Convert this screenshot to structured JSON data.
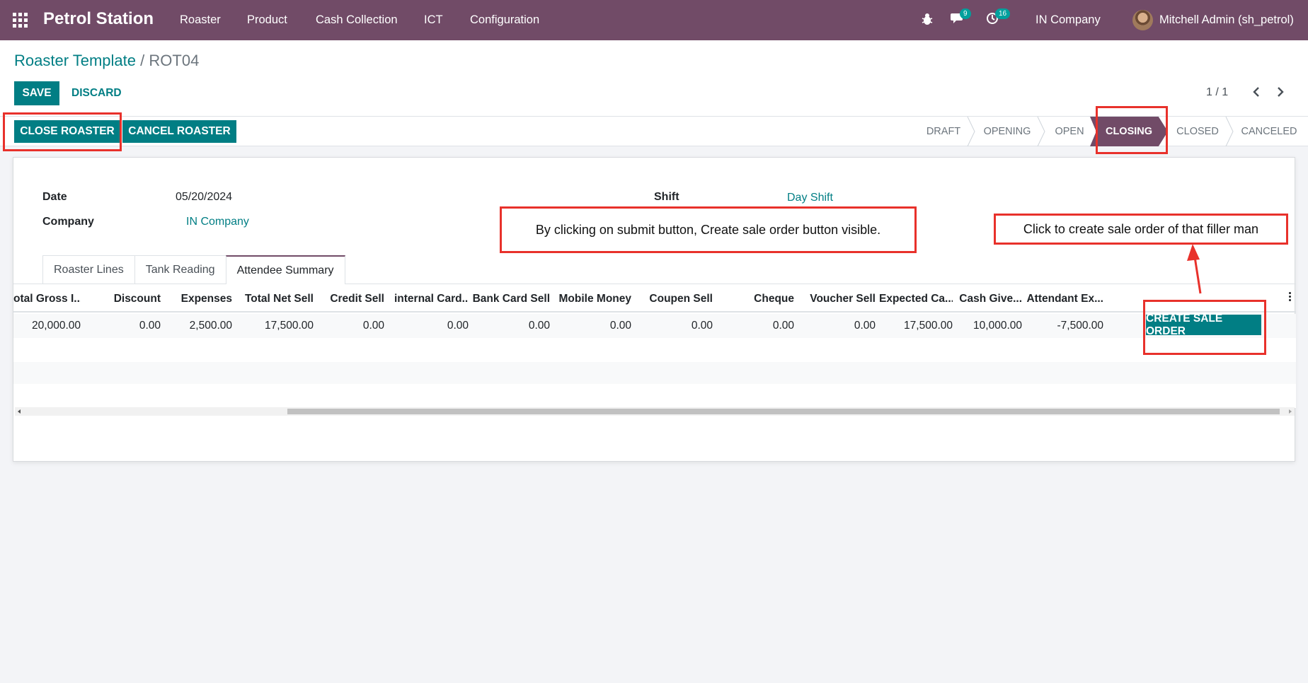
{
  "navbar": {
    "brand": "Petrol Station",
    "menu": [
      "Roaster",
      "Product",
      "Cash Collection",
      "ICT",
      "Configuration"
    ],
    "messages_count": "9",
    "activities_count": "16",
    "company": "IN Company",
    "user": "Mitchell Admin (sh_petrol)"
  },
  "breadcrumb": {
    "parent": "Roaster Template",
    "separator": "/",
    "current": "ROT04"
  },
  "toolbar": {
    "save_label": "SAVE",
    "discard_label": "DISCARD",
    "pager": "1 / 1"
  },
  "header_buttons": {
    "close_label": "CLOSE ROASTER",
    "cancel_label": "CANCEL ROASTER"
  },
  "statusbar": {
    "steps": [
      "DRAFT",
      "OPENING",
      "OPEN",
      "CLOSING",
      "CLOSED",
      "CANCELED"
    ],
    "active": "CLOSING"
  },
  "form": {
    "date_label": "Date",
    "date_value": "05/20/2024",
    "company_label": "Company",
    "company_value": "IN Company",
    "shift_label": "Shift",
    "shift_value": "Day Shift"
  },
  "tabs": [
    "Roaster Lines",
    "Tank Reading",
    "Attendee Summary"
  ],
  "active_tab": "Attendee Summary",
  "table": {
    "columns": [
      "otal Gross I...",
      "Discount",
      "Expenses",
      "Total Net Sell",
      "Credit Sell",
      "internal Card...",
      "Bank Card Sell",
      "Mobile Money",
      "Coupen Sell",
      "Cheque",
      "Voucher Sell",
      "Expected Ca...",
      "Cash Give...",
      "Attendant Ex..."
    ],
    "rows": [
      [
        "20,000.00",
        "0.00",
        "2,500.00",
        "17,500.00",
        "0.00",
        "0.00",
        "0.00",
        "0.00",
        "0.00",
        "0.00",
        "0.00",
        "17,500.00",
        "10,000.00",
        "-7,500.00"
      ]
    ],
    "row_button": "CREATE SALE ORDER"
  },
  "annotations": {
    "note_submit": "By clicking on submit button, Create sale order button visible.",
    "note_create": "Click to create sale order of that filler man"
  },
  "colors": {
    "navbar": "#714b67",
    "primary": "#017e84",
    "annotation": "#e8312b"
  }
}
